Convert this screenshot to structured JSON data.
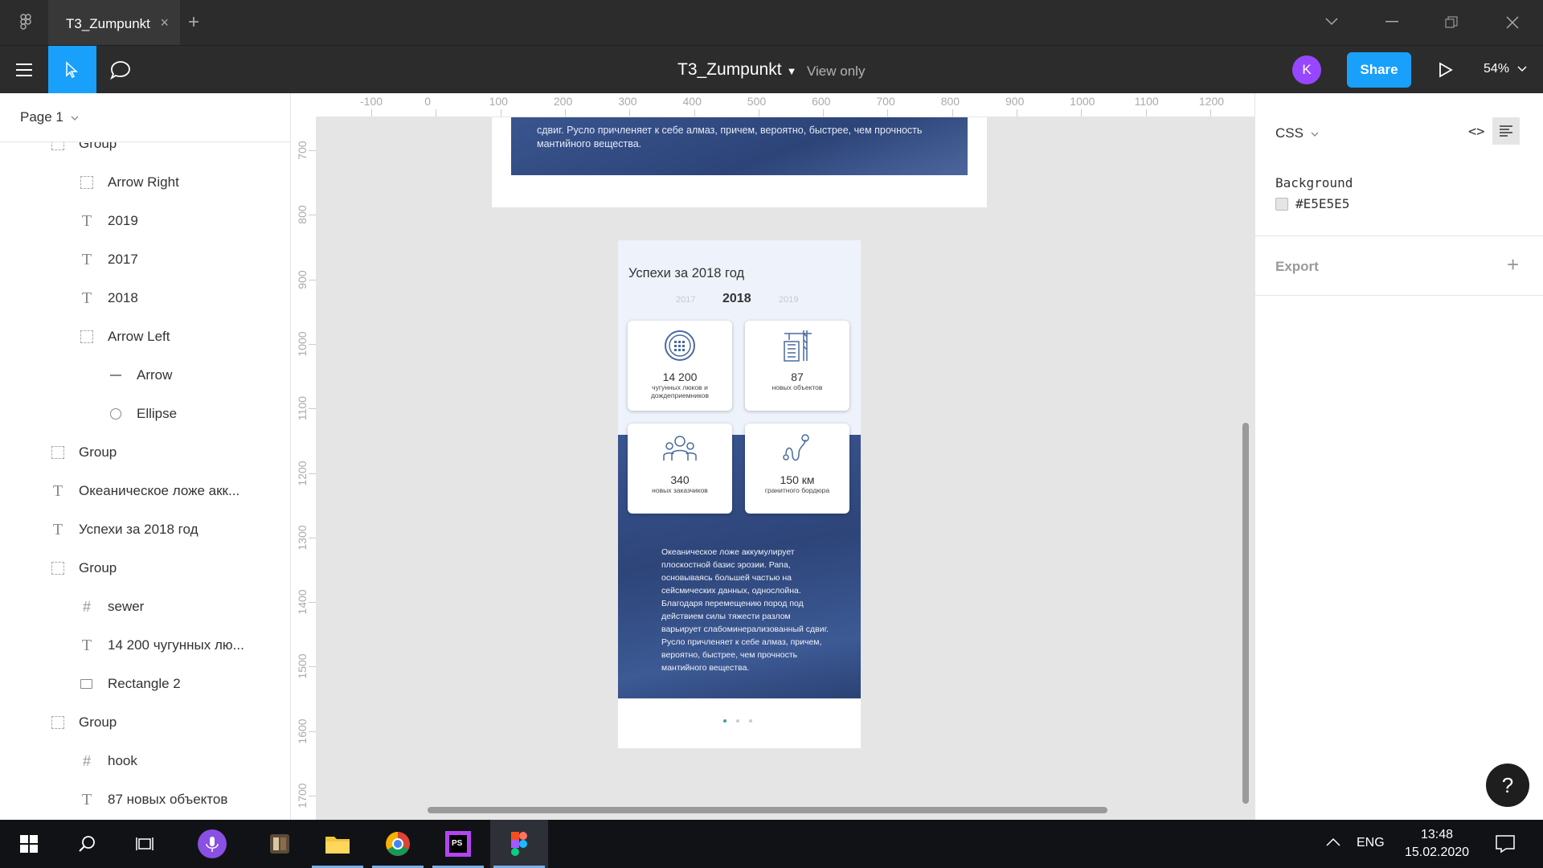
{
  "window": {
    "tab_title": "T3_Zumpunkt",
    "tab_close": "×",
    "new_tab": "+"
  },
  "toolbar": {
    "doc_title": "T3_Zumpunkt",
    "view_only": "View only",
    "avatar_letter": "K",
    "share_label": "Share",
    "zoom": "54%"
  },
  "left_panel": {
    "page": "Page 1",
    "layers": [
      {
        "name": "Group",
        "type": "frame",
        "indent": 1
      },
      {
        "name": "Arrow Right",
        "type": "frame",
        "indent": 2
      },
      {
        "name": "2019",
        "type": "text",
        "indent": 2
      },
      {
        "name": "2017",
        "type": "text",
        "indent": 2
      },
      {
        "name": "2018",
        "type": "text",
        "indent": 2
      },
      {
        "name": "Arrow Left",
        "type": "frame",
        "indent": 2
      },
      {
        "name": "Arrow",
        "type": "line",
        "indent": 3
      },
      {
        "name": "Ellipse",
        "type": "ellipse",
        "indent": 3
      },
      {
        "name": "Group",
        "type": "frame",
        "indent": 1
      },
      {
        "name": "Океаническое ложе акк...",
        "type": "text",
        "indent": 1
      },
      {
        "name": "Успехи за 2018 год",
        "type": "text",
        "indent": 1
      },
      {
        "name": "Group",
        "type": "frame",
        "indent": 1
      },
      {
        "name": "sewer",
        "type": "hash",
        "indent": 2
      },
      {
        "name": "14 200 чугунных лю...",
        "type": "text",
        "indent": 2
      },
      {
        "name": "Rectangle 2",
        "type": "rect",
        "indent": 2
      },
      {
        "name": "Group",
        "type": "frame",
        "indent": 1
      },
      {
        "name": "hook",
        "type": "hash",
        "indent": 2
      },
      {
        "name": "87 новых объектов",
        "type": "text",
        "indent": 2
      }
    ]
  },
  "ruler": {
    "x_ticks": [
      "-100",
      "0",
      "100",
      "200",
      "300",
      "400",
      "500",
      "600",
      "700",
      "800",
      "900",
      "1000",
      "1100",
      "1200"
    ],
    "y_ticks": [
      "700",
      "800",
      "900",
      "1000",
      "1100",
      "1200",
      "1300",
      "1400",
      "1500",
      "1600",
      "1700"
    ]
  },
  "frame_top": {
    "text": "сдвиг. Русло причленяет к себе алмаз, причем, вероятно, быстрее, чем прочность мантийного вещества."
  },
  "phone": {
    "title": "Успехи за 2018 год",
    "years": {
      "prev": "2017",
      "current": "2018",
      "next": "2019"
    },
    "cards": [
      {
        "num": "14 200",
        "desc": "чугунных люков и дождеприемников",
        "icon": "manhole-icon"
      },
      {
        "num": "87",
        "desc": "новых объектов",
        "icon": "crane-icon"
      },
      {
        "num": "340",
        "desc": "новых заказчиков",
        "icon": "people-icon"
      },
      {
        "num": "150 км",
        "desc": "гранитного бордюра",
        "icon": "route-icon"
      }
    ],
    "body": "Океаническое ложе аккумулирует плоскостной базис эрозии. Рапа, основываясь большей частью на сейсмических данных, однослойна. Благодаря перемещению пород под действием силы тяжести разлом варьирует слабоминерализованный сдвиг. Русло причленяет к себе алмаз, причем, вероятно, быстрее, чем прочность мантийного вещества."
  },
  "right_panel": {
    "css_label": "CSS",
    "code_icon": "<>",
    "background_label": "Background",
    "background_value": "#E5E5E5",
    "export_label": "Export",
    "export_add": "+",
    "help": "?"
  },
  "taskbar": {
    "lang": "ENG",
    "time": "13:48",
    "date": "15.02.2020"
  },
  "colors": {
    "accent": "#18a0fb",
    "avatar": "#9747ff",
    "canvas_bg": "#E5E5E5"
  }
}
